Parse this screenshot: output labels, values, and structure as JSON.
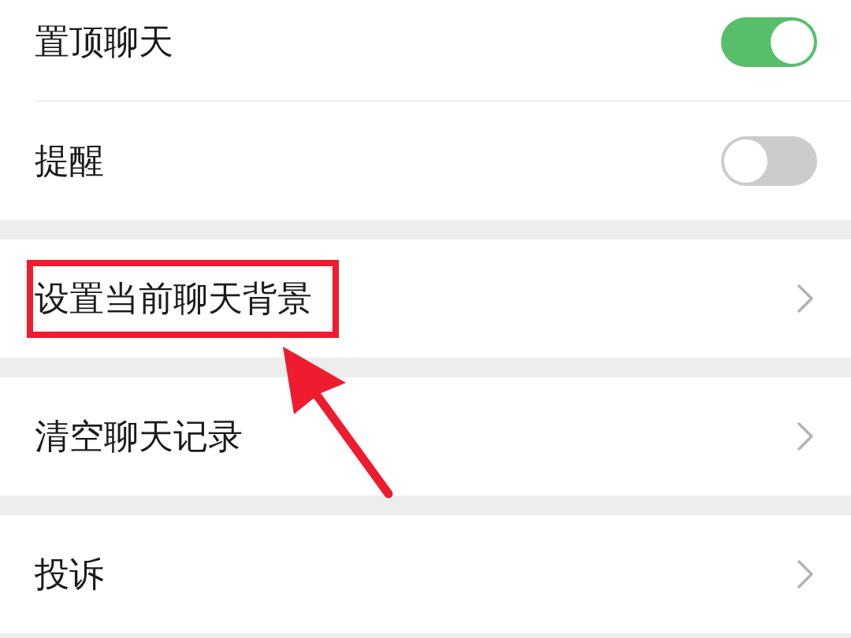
{
  "groups": [
    {
      "rows": [
        {
          "kind": "toggle",
          "label": "置顶聊天",
          "on": true,
          "highlighted": false
        },
        {
          "kind": "toggle",
          "label": "提醒",
          "on": false,
          "highlighted": false
        }
      ]
    },
    {
      "rows": [
        {
          "kind": "link",
          "label": "设置当前聊天背景",
          "highlighted": true
        }
      ]
    },
    {
      "rows": [
        {
          "kind": "link",
          "label": "清空聊天记录",
          "highlighted": false
        }
      ]
    },
    {
      "rows": [
        {
          "kind": "link",
          "label": "投诉",
          "highlighted": false
        }
      ]
    }
  ]
}
